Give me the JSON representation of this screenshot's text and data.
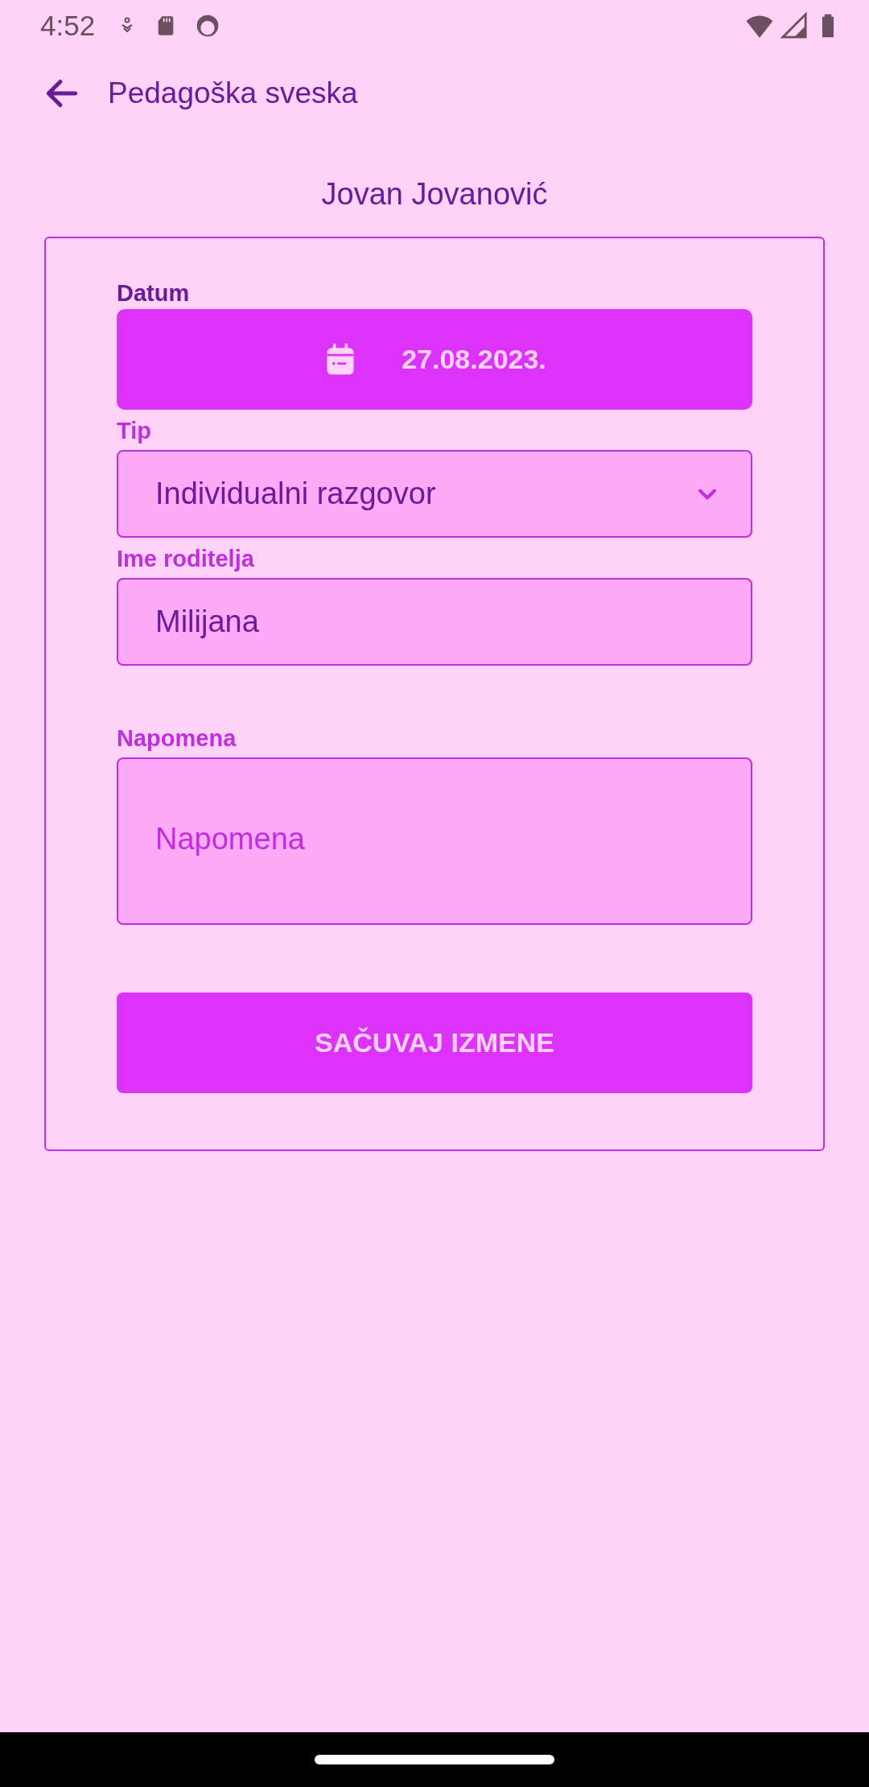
{
  "status_bar": {
    "time": "4:52"
  },
  "app_bar": {
    "title": "Pedagoška sveska"
  },
  "student_name": "Jovan Jovanović",
  "form": {
    "fields": [
      {
        "kind": "date",
        "label": "Datum",
        "value": "27.08.2023."
      },
      {
        "kind": "dropdown",
        "label": "Tip",
        "value": "Individualni razgovor"
      },
      {
        "kind": "text",
        "label": "Ime roditelja",
        "value": "Milijana"
      },
      {
        "kind": "textarea",
        "label": "Napomena",
        "placeholder": "Napomena"
      }
    ],
    "submit_button": "SAČUVAJ IZMENE"
  }
}
